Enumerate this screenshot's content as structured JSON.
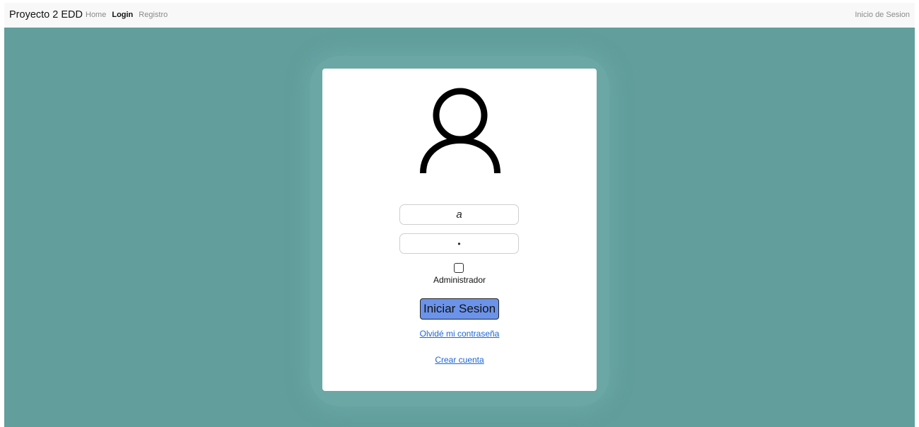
{
  "navbar": {
    "brand": "Proyecto 2 EDD",
    "links": [
      {
        "label": "Home",
        "active": false
      },
      {
        "label": "Login",
        "active": true
      },
      {
        "label": "Registro",
        "active": false
      }
    ],
    "right_label": "Inicio de Sesion"
  },
  "login": {
    "avatar_icon": "user-avatar-icon",
    "username_value": "a",
    "password_value": "•",
    "admin_checkbox_checked": false,
    "admin_label": "Administrador",
    "submit_label": "Iniciar Sesion",
    "forgot_label": "Olvidé mi contraseña",
    "create_label": "Crear cuenta"
  },
  "colors": {
    "background": "#619e9c",
    "navbar": "#f8f8f8",
    "button": "#6b93ea",
    "link": "#1a66d6"
  }
}
